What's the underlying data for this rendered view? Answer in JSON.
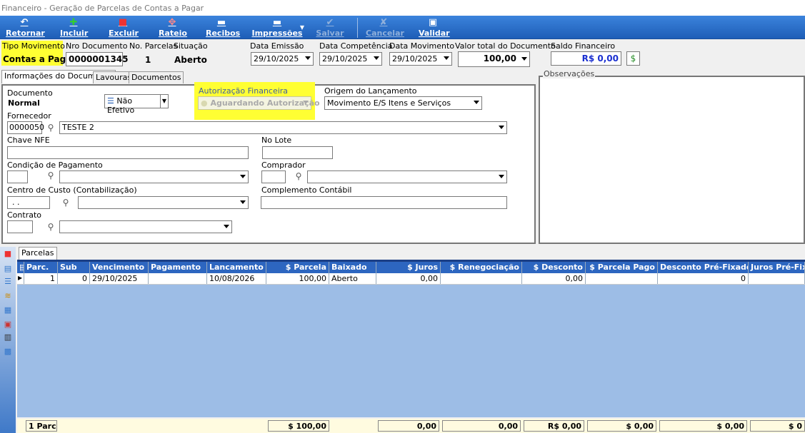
{
  "window": {
    "title": "Financeiro - Geração de Parcelas de Contas a Pagar"
  },
  "toolbar": {
    "retornar": "Retornar",
    "incluir": "Incluir",
    "excluir": "Excluir",
    "rateio": "Rateio",
    "recibos": "Recibos",
    "impressoes": "Impressões",
    "salvar": "Salvar",
    "cancelar": "Cancelar",
    "validar": "Validar"
  },
  "header": {
    "tipo_movimento_label": "Tipo Movimento",
    "tipo_movimento_value": "Contas a Pagar",
    "nro_documento_label": "Nro Documento",
    "nro_documento_value": "0000001345",
    "no_parcelas_label": "No. Parcelas",
    "no_parcelas_value": "1",
    "situacao_label": "Situação",
    "situacao_value": "Aberto",
    "data_emissao_label": "Data Emissão",
    "data_emissao_value": "29/10/2025",
    "data_competencia_label": "Data Competência",
    "data_competencia_value": "29/10/2025",
    "data_movimento_label": "Data Movimento",
    "data_movimento_value": "29/10/2025",
    "valor_total_label": "Valor total do Documento",
    "valor_total_value": "100,00",
    "saldo_label": "Saldo Financeiro",
    "saldo_value": "R$ 0,00"
  },
  "tabs": {
    "informacoes": "Informações do Documento",
    "lavouras": "Lavouras",
    "documentos": "Documentos"
  },
  "form": {
    "documento_label": "Documento",
    "documento_value": "Normal",
    "nao_efetivo": "Não Efetivo",
    "autorizacao_label": "Autorização Financeira",
    "autorizacao_value": "Aguardando Autorização",
    "origem_label": "Origem do Lançamento",
    "origem_value": "Movimento E/S Itens e Serviços",
    "fornecedor_label": "Fornecedor",
    "fornecedor_code": "0000050",
    "fornecedor_name": "TESTE 2",
    "chave_nfe_label": "Chave NFE",
    "no_lote_label": "No Lote",
    "condicao_label": "Condição de Pagamento",
    "comprador_label": "Comprador",
    "centro_custo_label": "Centro de Custo (Contabilização)",
    "centro_custo_value": ".  .",
    "complemento_label": "Complemento Contábil",
    "contrato_label": "Contrato"
  },
  "observacoes_label": "Observações",
  "parcelas_tab": "Parcelas",
  "grid": {
    "columns": [
      "Parc.",
      "Sub",
      "Vencimento",
      "Pagamento",
      "Lancamento",
      "$ Parcela",
      "Baixado",
      "$ Juros",
      "$ Renegociação",
      "$ Desconto",
      "$ Parcela Pago",
      "Desconto Pré-Fixado",
      "Juros Pré-Fix"
    ],
    "row": [
      "1",
      "0",
      "29/10/2025",
      "",
      "10/08/2026",
      "100,00",
      "Aberto",
      "0,00",
      "",
      "0,00",
      "",
      "0",
      ""
    ],
    "footer": {
      "parc": "1 Parc",
      "parcela": "$ 100,00",
      "juros": "0,00",
      "reneg": "0,00",
      "desconto": "R$ 0,00",
      "pago": "$ 0,00",
      "desc_pre": "$ 0,00",
      "juros_pre": "$ 0"
    }
  }
}
